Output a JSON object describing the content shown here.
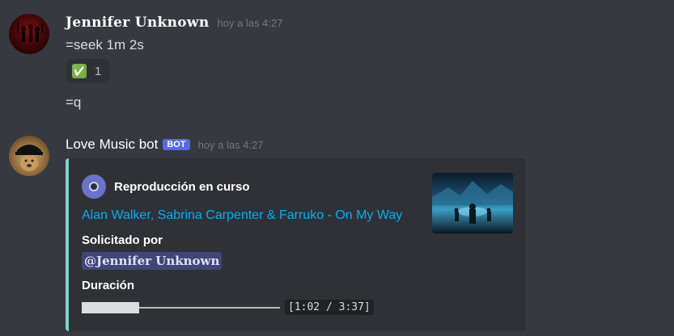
{
  "messages": [
    {
      "author": "Jennifer Unknown",
      "time": "hoy a las 4:27",
      "lines": [
        "=seek 1m 2s",
        "=q"
      ],
      "reaction": {
        "emoji": "✅",
        "count": "1"
      }
    },
    {
      "author": "Love Music bot",
      "bot_tag": "BOT",
      "time": "hoy a las 4:27",
      "embed": {
        "author": "Reproducción en curso",
        "title": "Alan Walker, Sabrina Carpenter & Farruko - On My Way",
        "fields": [
          {
            "name": "Solicitado por",
            "value": "@Jennifer Unknown"
          },
          {
            "name": "Duración",
            "value": "[1:02 / 3:37]"
          }
        ],
        "progress_fraction": 0.29,
        "accent_color": "#7fd3cc"
      }
    }
  ],
  "colors": {
    "background": "#36393f",
    "embed_bg": "#2f3136",
    "link": "#00aff4",
    "bot_tag": "#5865f2"
  }
}
